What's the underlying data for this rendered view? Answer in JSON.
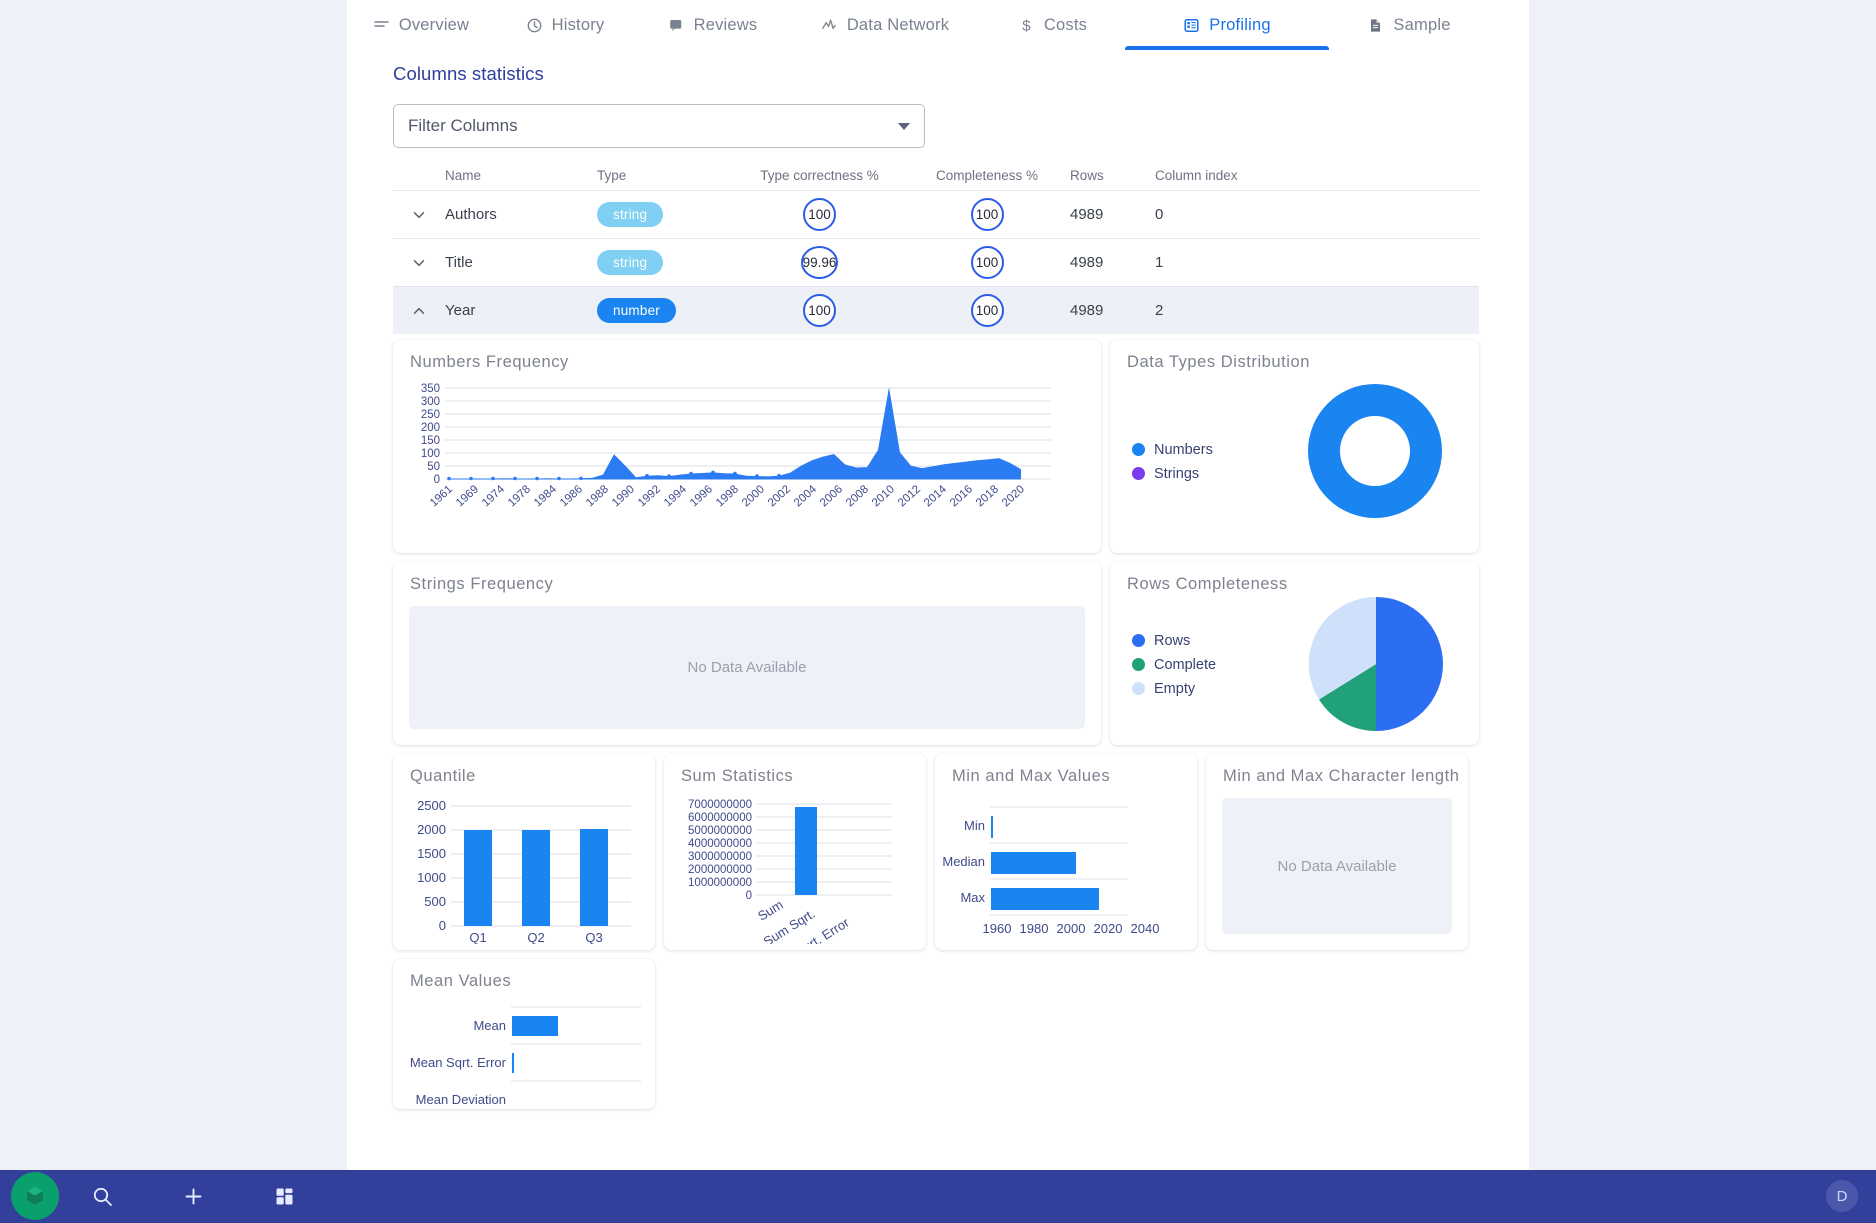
{
  "tabs": [
    {
      "label": "Overview",
      "icon": "list-icon",
      "active": false
    },
    {
      "label": "History",
      "icon": "clock-icon",
      "active": false
    },
    {
      "label": "Reviews",
      "icon": "comment-icon",
      "active": false
    },
    {
      "label": "Data Network",
      "icon": "activity-icon",
      "active": false
    },
    {
      "label": "Costs",
      "icon": "dollar-icon",
      "active": false
    },
    {
      "label": "Profiling",
      "icon": "table-icon",
      "active": true
    },
    {
      "label": "Sample",
      "icon": "document-icon",
      "active": false
    }
  ],
  "page": {
    "title": "Columns statistics"
  },
  "filter": {
    "label": "Filter Columns",
    "caret_icon": "chevron-down-icon"
  },
  "table": {
    "headers": [
      "Name",
      "Type",
      "Type correctness %",
      "Completeness %",
      "Rows",
      "Column index"
    ],
    "rows": [
      {
        "name": "Authors",
        "type": "string",
        "type_correctness": "100",
        "completeness": "100",
        "rows": "4989",
        "index": "0",
        "expanded": false
      },
      {
        "name": "Title",
        "type": "string",
        "type_correctness": "99.96",
        "completeness": "100",
        "rows": "4989",
        "index": "1",
        "expanded": false
      },
      {
        "name": "Year",
        "type": "number",
        "type_correctness": "100",
        "completeness": "100",
        "rows": "4989",
        "index": "2",
        "expanded": true
      }
    ]
  },
  "cards": {
    "numbers_frequency": {
      "title": "Numbers Frequency"
    },
    "data_types": {
      "title": "Data Types Distribution"
    },
    "strings_frequency": {
      "title": "Strings Frequency",
      "empty_text": "No Data Available"
    },
    "rows_completeness": {
      "title": "Rows Completeness"
    },
    "quantile": {
      "title": "Quantile"
    },
    "sum_statistics": {
      "title": "Sum Statistics"
    },
    "min_max_values": {
      "title": "Min and Max Values"
    },
    "min_max_char": {
      "title": "Min and Max Character length",
      "empty_text": "No Data Available"
    },
    "mean_values": {
      "title": "Mean Values"
    }
  },
  "taskbar": {
    "logo_icon": "app-logo-icon",
    "search_icon": "search-icon",
    "add_icon": "plus-icon",
    "apps_icon": "apps-grid-icon",
    "avatar_initial": "D"
  },
  "colors": {
    "accent": "#1a84f0",
    "accent_dark": "#2b5ce6",
    "purple": "#7c3aed",
    "green": "#21a179",
    "light_blue": "#cfe0fb",
    "pill_string": "#7fd0f2",
    "taskbar": "#32409c",
    "title_blue": "#2f3e9e"
  },
  "chart_data": [
    {
      "type": "area",
      "name": "numbers_frequency",
      "title": "Numbers Frequency",
      "xlabel": "",
      "ylabel": "",
      "ylim": [
        0,
        350
      ],
      "yticks": [
        0,
        50,
        100,
        150,
        200,
        250,
        300,
        350
      ],
      "grid": true,
      "legend": "none",
      "tick_labels": [
        "1961",
        "1969",
        "1974",
        "1978",
        "1984",
        "1986",
        "1988",
        "1990",
        "1992",
        "1994",
        "1996",
        "1998",
        "2000",
        "2002",
        "2004",
        "2006",
        "2008",
        "2010",
        "2012",
        "2014",
        "2016",
        "2018",
        "2020"
      ],
      "x": [
        1961,
        1969,
        1971,
        1972,
        1973,
        1974,
        1975,
        1976,
        1977,
        1978,
        1979,
        1980,
        1981,
        1982,
        1983,
        1984,
        1985,
        1986,
        1987,
        1988,
        1989,
        1990,
        1991,
        1992,
        1993,
        1994,
        1995,
        1996,
        1997,
        1998,
        1999,
        2000,
        2001,
        2002,
        2003,
        2004,
        2005,
        2006,
        2007,
        2008,
        2009,
        2010,
        2011,
        2012,
        2013,
        2014,
        2015,
        2016,
        2017,
        2018,
        2019,
        2020,
        2021
      ],
      "values": [
        2,
        2,
        2,
        2,
        2,
        3,
        2,
        2,
        2,
        3,
        2,
        2,
        3,
        4,
        15,
        92,
        40,
        6,
        10,
        12,
        9,
        14,
        18,
        20,
        22,
        19,
        18,
        12,
        10,
        9,
        12,
        24,
        52,
        78,
        95,
        104,
        58,
        44,
        46,
        150,
        352,
        120,
        52,
        42,
        50,
        60,
        66,
        72,
        78,
        82,
        88,
        72,
        42
      ]
    },
    {
      "type": "pie",
      "name": "data_types_distribution",
      "title": "Data Types Distribution",
      "donut": true,
      "legend": "left",
      "labels": [
        "Numbers",
        "Strings"
      ],
      "values": [
        100,
        0
      ],
      "colors": [
        "#1a84f0",
        "#7c3aed"
      ]
    },
    {
      "type": "pie",
      "name": "rows_completeness",
      "title": "Rows Completeness",
      "donut": false,
      "legend": "left",
      "labels": [
        "Rows",
        "Complete",
        "Empty"
      ],
      "values": [
        50,
        16,
        34
      ],
      "colors": [
        "#2b6ef2",
        "#21a179",
        "#cfe0fb"
      ]
    },
    {
      "type": "bar",
      "name": "quantile",
      "title": "Quantile",
      "categories": [
        "Q1",
        "Q2",
        "Q3"
      ],
      "values": [
        1999,
        2006,
        2010
      ],
      "ylim": [
        0,
        2500
      ],
      "yticks": [
        0,
        500,
        1000,
        1500,
        2000,
        2500
      ],
      "grid": true
    },
    {
      "type": "bar",
      "name": "sum_statistics",
      "title": "Sum Statistics",
      "categories": [
        "Sum",
        "Sum Sqrt.",
        "Sum Sqrt. Error"
      ],
      "values": [
        6800000000,
        0,
        0
      ],
      "ylim": [
        0,
        7000000000
      ],
      "yticks": [
        0,
        1000000000,
        2000000000,
        3000000000,
        4000000000,
        5000000000,
        6000000000,
        7000000000
      ],
      "ytick_labels": [
        "0",
        "1000000000",
        "2000000000",
        "3000000000",
        "4000000000",
        "5000000000",
        "6000000000",
        "7000000000"
      ],
      "grid": true
    },
    {
      "type": "bar",
      "name": "min_and_max_values",
      "title": "Min and Max Values",
      "orientation": "horizontal",
      "categories": [
        "Min",
        "Median",
        "Max"
      ],
      "values": [
        1961,
        2006,
        2021
      ],
      "xlim": [
        1950,
        2050
      ],
      "xticks": [
        1960,
        1980,
        2000,
        2020,
        2040
      ],
      "xtick_labels": [
        "1960",
        "1980",
        "2000",
        "2020",
        "2040"
      ],
      "grid": true
    },
    {
      "type": "bar",
      "name": "mean_values",
      "title": "Mean Values",
      "orientation": "horizontal",
      "categories": [
        "Mean",
        "Mean Sqrt. Error",
        "Mean Deviation"
      ],
      "values": [
        2002,
        0,
        0
      ],
      "grid": true
    }
  ]
}
